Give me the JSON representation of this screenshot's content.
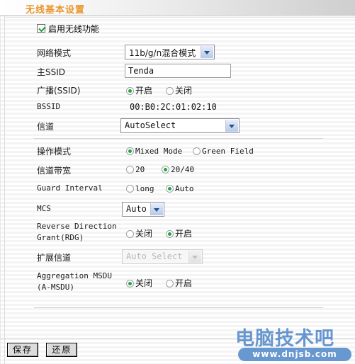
{
  "header": {
    "title": "无线基本设置"
  },
  "enable_wireless": {
    "label": "启用无线功能",
    "checked": true
  },
  "fields": {
    "network_mode": {
      "label": "网络模式",
      "value": "11b/g/n混合模式"
    },
    "primary_ssid": {
      "label": "主SSID",
      "value": "Tenda"
    },
    "broadcast_ssid": {
      "label": "广播(SSID)",
      "option_on": "开启",
      "option_off": "关闭",
      "selected": "开启"
    },
    "bssid": {
      "label": "BSSID",
      "value": "00:B0:2C:01:02:10"
    },
    "channel": {
      "label": "信道",
      "value": "AutoSelect"
    },
    "operating_mode": {
      "label": "操作模式",
      "option_a": "Mixed Mode",
      "option_b": "Green Field",
      "selected": "Mixed Mode"
    },
    "channel_bandwidth": {
      "label": "信道带宽",
      "option_a": "20",
      "option_b": "20/40",
      "selected": "20/40"
    },
    "guard_interval": {
      "label": "Guard Interval",
      "option_a": "long",
      "option_b": "Auto",
      "selected": "Auto"
    },
    "mcs": {
      "label": "MCS",
      "value": "Auto"
    },
    "rdg": {
      "label_line1": "Reverse Direction",
      "label_line2": "Grant(RDG)",
      "option_off": "关闭",
      "option_on": "开启",
      "selected": "开启"
    },
    "extension_channel": {
      "label": "扩展信道",
      "value": "Auto Select",
      "disabled": true
    },
    "amsdu": {
      "label_line1": "Aggregation MSDU",
      "label_line2": "(A-MSDU)",
      "option_off": "关闭",
      "option_on": "开启",
      "selected": "关闭"
    }
  },
  "buttons": {
    "save": "保存",
    "restore": "还原"
  },
  "watermark": {
    "site_name": "电脑技术吧",
    "url": "www.dnjsb.com"
  },
  "colors": {
    "title_orange": "#e8962c",
    "radio_green": "#29a33a",
    "watermark_blue": "#5b8fcc"
  }
}
